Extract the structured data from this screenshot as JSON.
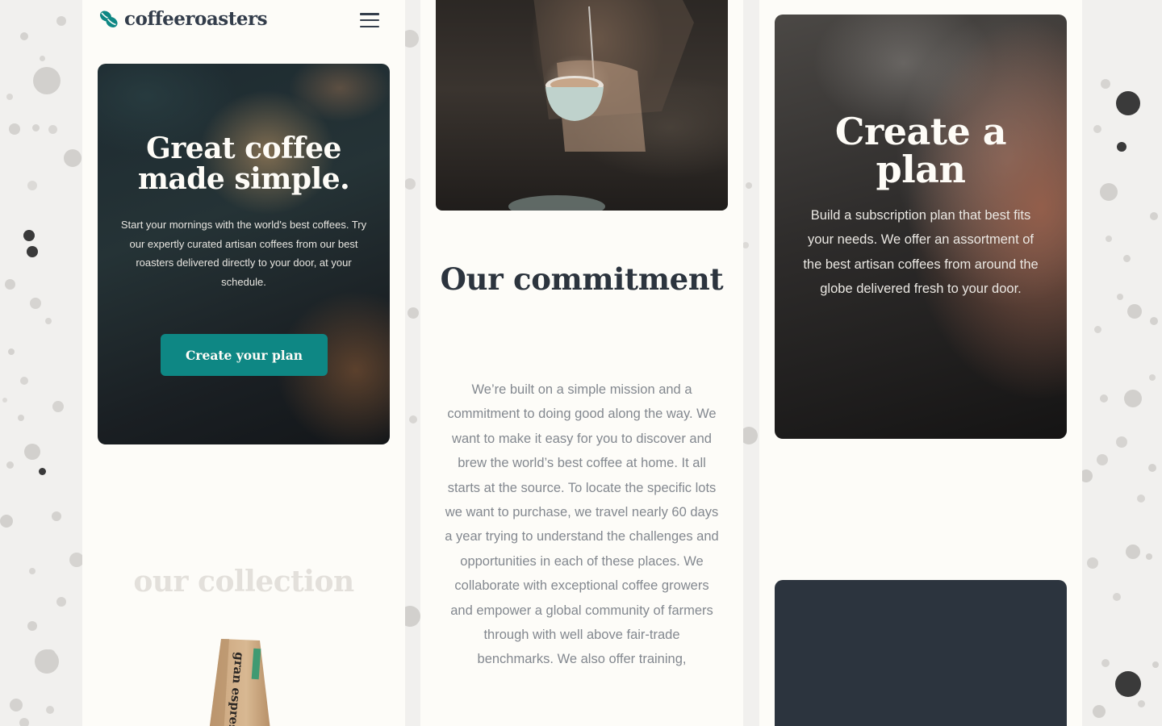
{
  "brand": {
    "name": "coffeeroasters",
    "icon": "coffee-bean-logo-icon",
    "accent_color": "#0e8784",
    "dark_color": "#333d4b"
  },
  "header": {
    "menu_icon": "hamburger-menu-icon"
  },
  "hero": {
    "title": "Great coffee made simple.",
    "text": "Start your mornings with the world's best coffees. Try our expertly curated artisan coffees from our best roasters delivered directly to your door, at your schedule.",
    "cta_label": "Create your plan"
  },
  "collection": {
    "heading": "our collection",
    "product_label": "gran espresso"
  },
  "commitment": {
    "title": "Our commitment",
    "text": "We’re built on a simple mission and a commitment to doing good along the way. We want to make it easy for you to discover and brew the world’s best coffee at home. It all starts at the source. To locate the specific lots we want to purchase, we travel nearly 60 days a year trying to understand the challenges and opportunities in each of these places. We collaborate with exceptional coffee growers and empower a global community of farmers through with well above fair-trade benchmarks. We also offer training,"
  },
  "plan": {
    "title": "Create a plan",
    "text": "Build a subscription plan that best fits your needs. We offer an assortment of the best artisan coffees from around the globe delivered fresh to your door."
  }
}
